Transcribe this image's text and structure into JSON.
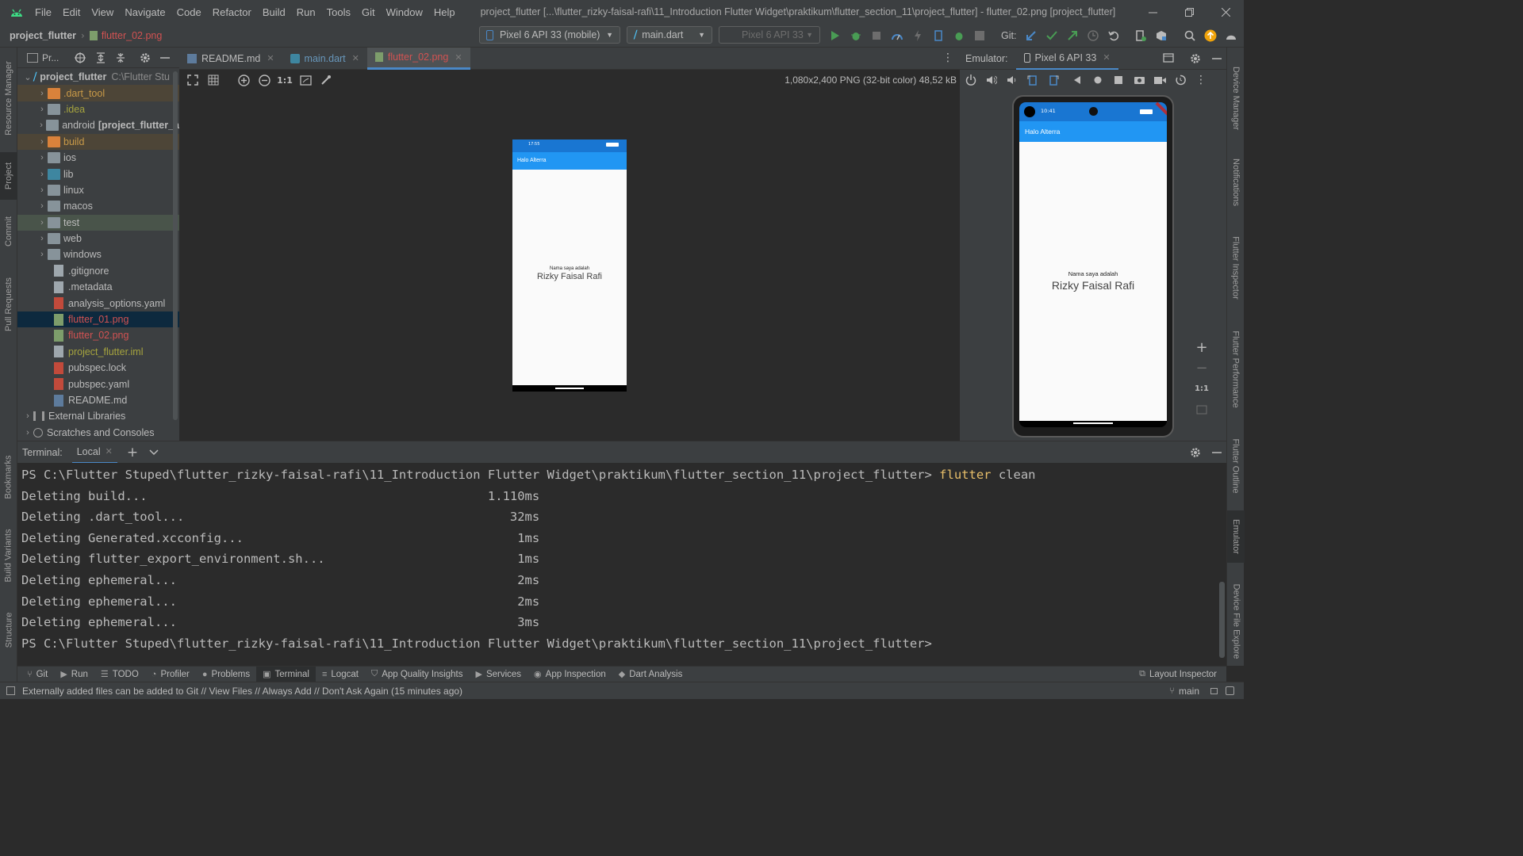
{
  "menubar": {
    "items": [
      "File",
      "Edit",
      "View",
      "Navigate",
      "Code",
      "Refactor",
      "Build",
      "Run",
      "Tools",
      "Git",
      "Window",
      "Help"
    ],
    "window_title": "project_flutter [...\\flutter_rizky-faisal-rafi\\11_Introduction Flutter Widget\\praktikum\\flutter_section_11\\project_flutter] - flutter_02.png [project_flutter]"
  },
  "navbar": {
    "breadcrumb_project": "project_flutter",
    "breadcrumb_file": "flutter_02.png",
    "device_selector": "Pixel 6 API 33 (mobile)",
    "run_config": "main.dart",
    "device_disabled": "Pixel 6 API 33",
    "git_label": "Git:"
  },
  "left_stripe": {
    "resource_manager": "Resource Manager",
    "project": "Project",
    "commit": "Commit",
    "pull_requests": "Pull Requests",
    "bookmarks": "Bookmarks",
    "build_variants": "Build Variants",
    "structure": "Structure"
  },
  "right_stripe": {
    "device_manager": "Device Manager",
    "notifications": "Notifications",
    "flutter_inspector": "Flutter Inspector",
    "flutter_performance": "Flutter Performance",
    "flutter_outline": "Flutter Outline",
    "emulator": "Emulator",
    "device_file_explorer": "Device File Explore"
  },
  "project_panel": {
    "header_label": "Pr...",
    "root_name": "project_flutter",
    "root_path": "C:\\Flutter Stu",
    "items": [
      {
        "label": ".dart_tool",
        "kind": "folder-orange",
        "style": "excluded"
      },
      {
        "label": ".idea",
        "kind": "folder-gear",
        "style": "olive"
      },
      {
        "label": "android",
        "suffix": "[project_flutter_a",
        "kind": "folder",
        "style": "normal"
      },
      {
        "label": "build",
        "kind": "folder-orange",
        "style": "excluded"
      },
      {
        "label": "ios",
        "kind": "folder",
        "style": "normal"
      },
      {
        "label": "lib",
        "kind": "folder-blue",
        "style": "normal"
      },
      {
        "label": "linux",
        "kind": "folder",
        "style": "normal"
      },
      {
        "label": "macos",
        "kind": "folder",
        "style": "normal"
      },
      {
        "label": "test",
        "kind": "folder-test",
        "style": "test"
      },
      {
        "label": "web",
        "kind": "folder",
        "style": "normal"
      },
      {
        "label": "windows",
        "kind": "folder",
        "style": "normal"
      }
    ],
    "files": [
      {
        "label": ".gitignore",
        "kind": "file",
        "style": "normal"
      },
      {
        "label": ".metadata",
        "kind": "file",
        "style": "normal"
      },
      {
        "label": "analysis_options.yaml",
        "kind": "yml",
        "style": "normal"
      },
      {
        "label": "flutter_01.png",
        "kind": "png",
        "style": "red-selected"
      },
      {
        "label": "flutter_02.png",
        "kind": "png",
        "style": "red"
      },
      {
        "label": "project_flutter.iml",
        "kind": "file",
        "style": "olive"
      },
      {
        "label": "pubspec.lock",
        "kind": "yml",
        "style": "normal"
      },
      {
        "label": "pubspec.yaml",
        "kind": "yml",
        "style": "normal"
      },
      {
        "label": "README.md",
        "kind": "md",
        "style": "normal"
      }
    ],
    "external_libraries": "External Libraries",
    "scratches": "Scratches and Consoles"
  },
  "editor": {
    "tabs": [
      {
        "label": "README.md",
        "active": false
      },
      {
        "label": "main.dart",
        "active": false
      },
      {
        "label": "flutter_02.png",
        "active": true
      }
    ],
    "image_info": "1,080x2,400 PNG (32-bit color) 48,52 kB",
    "zoom_actual": "1:1"
  },
  "phone_preview": {
    "status_time": "17:55",
    "appbar_title": "Halo Alterra",
    "line1": "Nama saya adalah",
    "line2": "Rizky Faisal Rafi"
  },
  "emulator": {
    "label": "Emulator:",
    "device_tab": "Pixel 6 API 33",
    "status_time": "10:41",
    "appbar_title": "Halo Alterra",
    "line1": "Nama saya adalah",
    "line2": "Rizky Faisal Rafi",
    "zoom_actual": "1:1"
  },
  "terminal": {
    "label": "Terminal:",
    "tab_local": "Local",
    "prompt": "PS C:\\Flutter Stuped\\flutter_rizky-faisal-rafi\\11_Introduction Flutter Widget\\praktikum\\flutter_section_11\\project_flutter>",
    "command_name": "flutter",
    "command_arg": "clean",
    "lines": [
      "Deleting build...                                              1.110ms",
      "Deleting .dart_tool...                                            32ms",
      "Deleting Generated.xcconfig...                                     1ms",
      "Deleting flutter_export_environment.sh...                          1ms",
      "Deleting ephemeral...                                              2ms",
      "Deleting ephemeral...                                              2ms",
      "Deleting ephemeral...                                              3ms"
    ],
    "final_prompt": "PS C:\\Flutter Stuped\\flutter_rizky-faisal-rafi\\11_Introduction Flutter Widget\\praktikum\\flutter_section_11\\project_flutter>"
  },
  "bottom_tools": {
    "git": "Git",
    "run": "Run",
    "todo": "TODO",
    "profiler": "Profiler",
    "problems": "Problems",
    "terminal": "Terminal",
    "logcat": "Logcat",
    "app_quality": "App Quality Insights",
    "services": "Services",
    "app_inspection": "App Inspection",
    "dart_analysis": "Dart Analysis",
    "layout_inspector": "Layout Inspector"
  },
  "statusbar": {
    "message": "Externally added files can be added to Git // View Files // Always Add // Don't Ask Again (15 minutes ago)",
    "branch": "main"
  },
  "colors": {
    "ide_bg": "#2b2b2b",
    "panel_bg": "#3c3f41",
    "flutter_blue": "#2196f3",
    "status_blue": "#1976d2",
    "accent": "#4a88c7",
    "excluded": "#c99a48",
    "error_red": "#d25252",
    "command_yellow": "#e8bf6a"
  }
}
